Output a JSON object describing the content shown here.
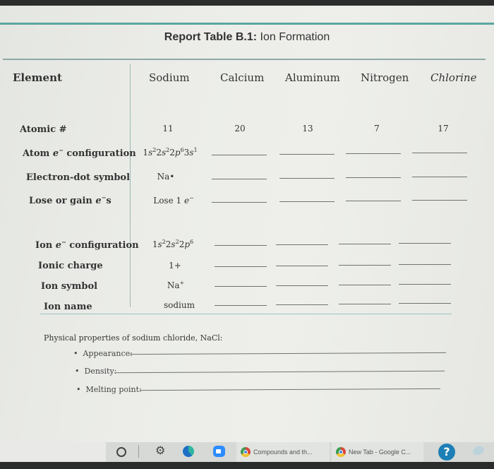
{
  "document": {
    "title_bold": "Report Table B.1:",
    "title_rest": " Ion Formation",
    "header": {
      "row_label": "Element",
      "elements": [
        "Sodium",
        "Calcium",
        "Aluminum",
        "Nitrogen",
        "Chlorine"
      ]
    },
    "rows": [
      {
        "label_html": "Atomic #",
        "values": [
          "11",
          "20",
          "13",
          "7",
          "17"
        ]
      },
      {
        "label_html": "Atom <i>e</i><sup>−</sup> configuration",
        "sodium_html": "1<i>s</i><sup>2</sup>2<i>s</i><sup>2</sup>2<i>p</i><sup>6</sup>3<i>s</i><sup>1</sup>"
      },
      {
        "label_html": "Electron-dot symbol",
        "sodium_html": "Na•"
      },
      {
        "label_html": "Lose or gain <i>e</i><sup>−</sup>s",
        "sodium_html": "Lose 1 <i>e</i><sup>−</sup>"
      },
      {
        "label_html": "Ion <i>e</i><sup>−</sup> configuration",
        "sodium_html": "1<i>s</i><sup>2</sup>2<i>s</i><sup>2</sup>2<i>p</i><sup>6</sup>"
      },
      {
        "label_html": "Ionic charge",
        "sodium_html": "1+"
      },
      {
        "label_html": "Ion symbol",
        "sodium_html": "Na<sup>+</sup>"
      },
      {
        "label_html": "Ion name",
        "sodium_html": "sodium"
      }
    ],
    "physical_properties": {
      "title": "Physical properties of sodium chloride, NaCl:",
      "items": [
        "Appearance:",
        "Density:",
        "Melting point:"
      ]
    }
  },
  "taskbar": {
    "icons": [
      "search-circle-icon",
      "settings-gear-icon",
      "edge-browser-icon",
      "zoom-app-icon"
    ],
    "tabs": [
      {
        "label": "Compounds and th...",
        "app": "chrome"
      },
      {
        "label": "New Tab - Google C...",
        "app": "chrome"
      }
    ],
    "help_label": "?"
  },
  "colors": {
    "accent_teal": "#5aa7a0",
    "edge_blue": "#2a7fd4",
    "zoom_blue": "#2d8cff",
    "help_blue": "#1d7fb6"
  }
}
